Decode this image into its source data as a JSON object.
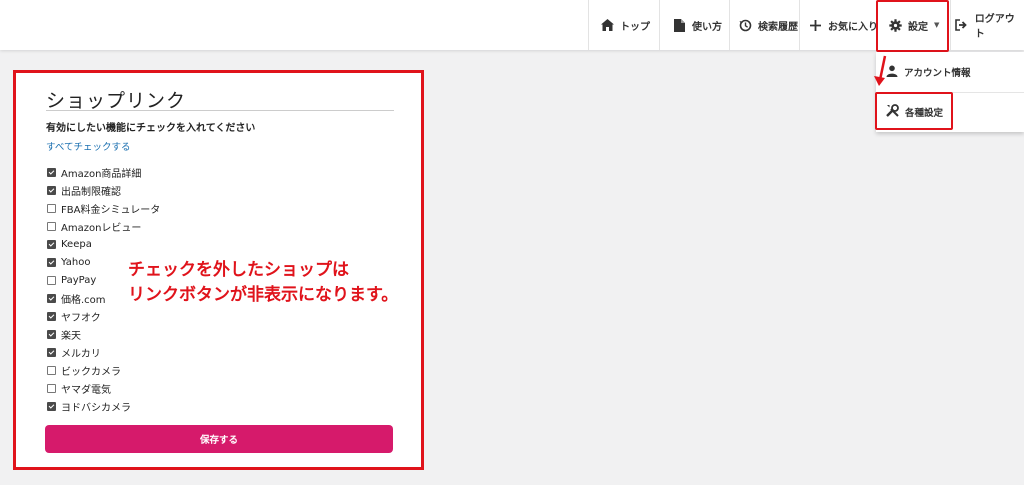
{
  "nav": {
    "top": "トップ",
    "usage": "使い方",
    "history": "検索履歴",
    "favorites": "お気に入り",
    "settings": "設定",
    "logout": "ログアウト"
  },
  "dropdown": {
    "account": "アカウント情報",
    "various": "各種設定"
  },
  "card": {
    "title": "ショップリンク",
    "instruction": "有効にしたい機能にチェックを入れてください",
    "check_all": "すべてチェックする",
    "options": [
      {
        "label": "Amazon商品詳細",
        "checked": true
      },
      {
        "label": "出品制限確認",
        "checked": true
      },
      {
        "label": "FBA料金シミュレータ",
        "checked": false
      },
      {
        "label": "Amazonレビュー",
        "checked": false
      },
      {
        "label": "Keepa",
        "checked": true
      },
      {
        "label": "Yahoo",
        "checked": true
      },
      {
        "label": "PayPay",
        "checked": false
      },
      {
        "label": "価格.com",
        "checked": true
      },
      {
        "label": "ヤフオク",
        "checked": true
      },
      {
        "label": "楽天",
        "checked": true
      },
      {
        "label": "メルカリ",
        "checked": true
      },
      {
        "label": "ビックカメラ",
        "checked": false
      },
      {
        "label": "ヤマダ電気",
        "checked": false
      },
      {
        "label": "ヨドバシカメラ",
        "checked": true
      }
    ],
    "save": "保存する"
  },
  "annotation": {
    "line1": "チェックを外したショップは",
    "line2": "リンクボタンが非表示になります。"
  },
  "colors": {
    "accent": "#d61a6b",
    "highlight": "#e0131b",
    "link": "#1a6fb0"
  }
}
